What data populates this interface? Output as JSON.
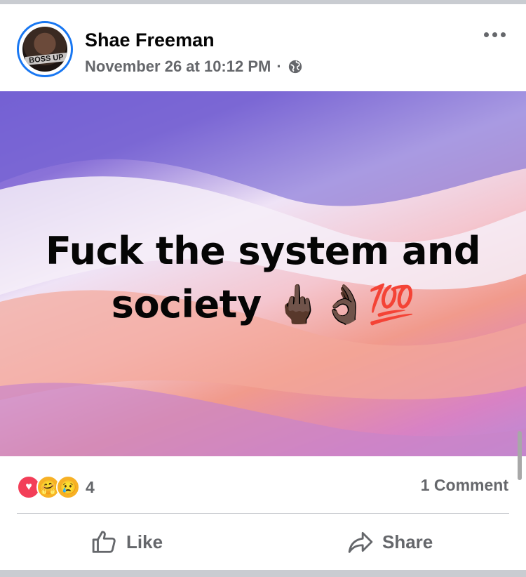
{
  "post": {
    "author": "Shae Freeman",
    "timestamp": "November 26 at 10:12 PM",
    "separator": "·",
    "privacy_icon": "globe-icon",
    "avatar_text": "BOSS UP",
    "text": "Fuck the system and society 🖕🏿👌🏿💯",
    "reactions": {
      "icons": [
        "love",
        "care",
        "sad"
      ],
      "count": "4"
    },
    "comments": "1 Comment",
    "actions": {
      "like": "Like",
      "share": "Share"
    }
  },
  "colors": {
    "accent": "#1877f2",
    "secondary_text": "#65676b",
    "love": "#f33e58",
    "care": "#f7b125"
  }
}
